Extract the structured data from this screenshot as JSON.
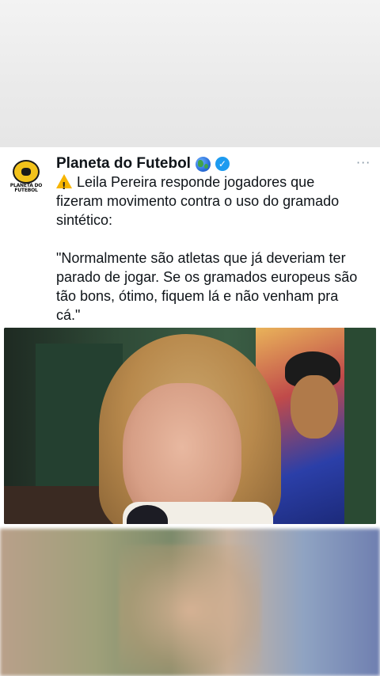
{
  "tweet": {
    "display_name": "Planeta do Futebol",
    "globe_emoji": "globe-icon",
    "verified": "verified-icon",
    "more": "···",
    "avatar_text": "PLANETA DO FUTEBOL",
    "lines": [
      "Leila Pereira responde jogadores que",
      "fizeram movimento contra o uso do gramado",
      "sintético:"
    ],
    "quote_lines": [
      "\"Normalmente são atletas que já deveriam ter",
      "parado de jogar. Se os gramados europeus são",
      "tão bons, ótimo, fiquem lá e não venham pra",
      "cá.\""
    ]
  }
}
